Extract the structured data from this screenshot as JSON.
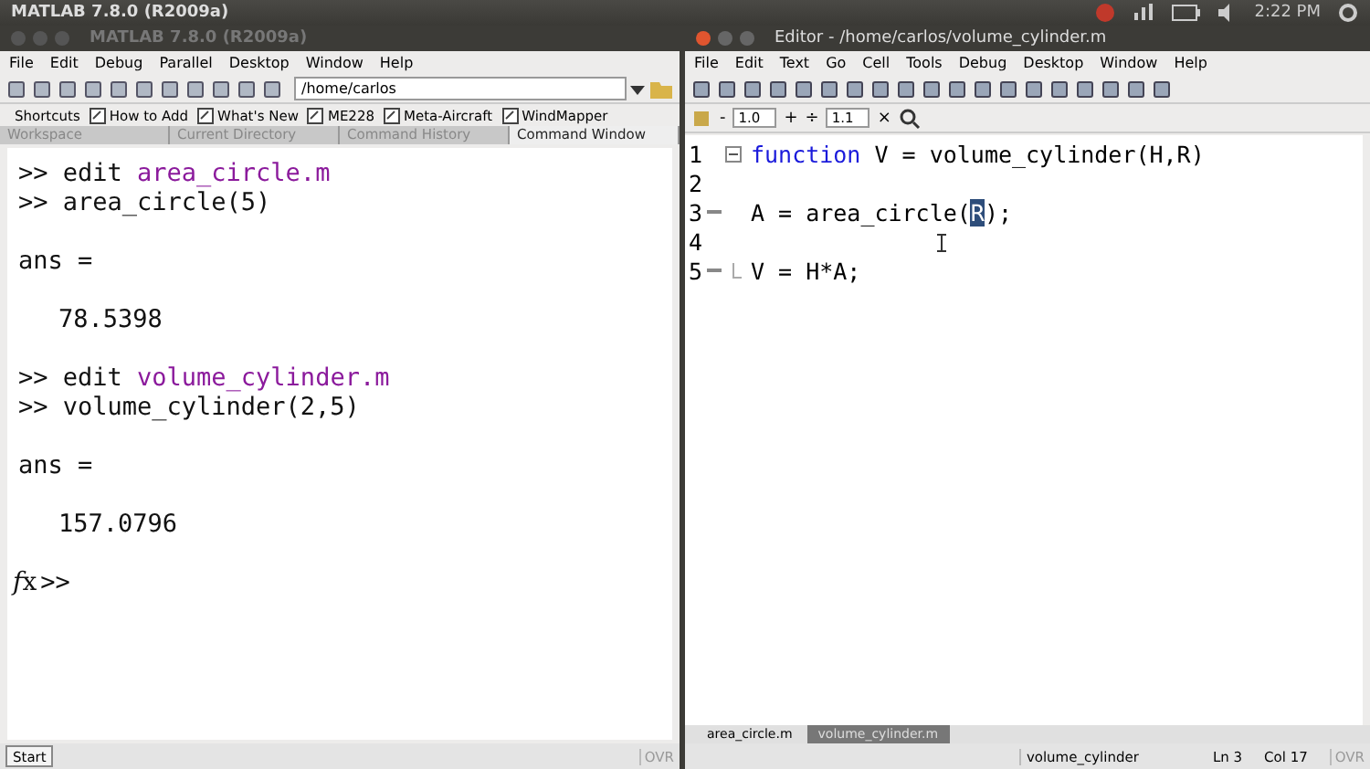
{
  "top_bar": {
    "title": "MATLAB  7.8.0 (R2009a)",
    "clock": "2:22 PM"
  },
  "main_window": {
    "title": "MATLAB  7.8.0 (R2009a)",
    "menu": [
      "File",
      "Edit",
      "Debug",
      "Parallel",
      "Desktop",
      "Window",
      "Help"
    ],
    "current_folder": "/home/carlos",
    "shortcuts_label": "Shortcuts",
    "shortcuts": [
      "How to Add",
      "What's New",
      "ME228",
      "Meta-Aircraft",
      "WindMapper"
    ],
    "tabs": [
      {
        "label": "Workspace",
        "selected": false
      },
      {
        "label": "Current Directory",
        "selected": false
      },
      {
        "label": "Command History",
        "selected": false
      },
      {
        "label": "Command Window",
        "selected": true
      }
    ],
    "lines": [
      {
        "kind": "input",
        "prompt": ">>",
        "code": "edit ",
        "link": "area_circle.m"
      },
      {
        "kind": "input",
        "prompt": ">>",
        "code": "area_circle(5)"
      },
      {
        "kind": "blank"
      },
      {
        "kind": "output",
        "text": "ans ="
      },
      {
        "kind": "blank"
      },
      {
        "kind": "value",
        "text": "78.5398"
      },
      {
        "kind": "blank"
      },
      {
        "kind": "input",
        "prompt": ">>",
        "code": "edit ",
        "link": "volume_cylinder.m"
      },
      {
        "kind": "input",
        "prompt": ">>",
        "code": "volume_cylinder(2,5)"
      },
      {
        "kind": "blank"
      },
      {
        "kind": "output",
        "text": "ans ="
      },
      {
        "kind": "blank"
      },
      {
        "kind": "value",
        "text": "157.0796"
      },
      {
        "kind": "blank"
      },
      {
        "kind": "fx",
        "prompt": ">>"
      }
    ],
    "start": "Start",
    "status": "OVR"
  },
  "editor": {
    "title": "Editor - /home/carlos/volume_cylinder.m",
    "menu": [
      "File",
      "Edit",
      "Text",
      "Go",
      "Cell",
      "Tools",
      "Debug",
      "Desktop",
      "Window",
      "Help"
    ],
    "cell_minus": "-",
    "cell_step": "1.0",
    "cell_plus": "+",
    "cell_divide": "÷",
    "cell_factor": "1.1",
    "cell_times": "×",
    "code": [
      {
        "number": "1",
        "kind": "fold_start",
        "executable": false,
        "keyword": "function",
        "text": " V = volume_cylinder(H,R)"
      },
      {
        "number": "2",
        "kind": "plain",
        "executable": false
      },
      {
        "number": "3",
        "kind": "plain",
        "executable": true,
        "text": "A = area_circle(",
        "selected_text": "R",
        "text_after": ");"
      },
      {
        "number": "4",
        "kind": "plain",
        "executable": false
      },
      {
        "number": "5",
        "kind": "fold_end",
        "executable": true,
        "text": "V = H*A;"
      }
    ],
    "file_tabs": [
      {
        "label": "area_circle.m",
        "selected": false
      },
      {
        "label": "volume_cylinder.m",
        "selected": true
      }
    ],
    "status": {
      "function": "volume_cylinder",
      "line": "Ln  3",
      "col": "Col  17",
      "mode": "OVR"
    }
  }
}
